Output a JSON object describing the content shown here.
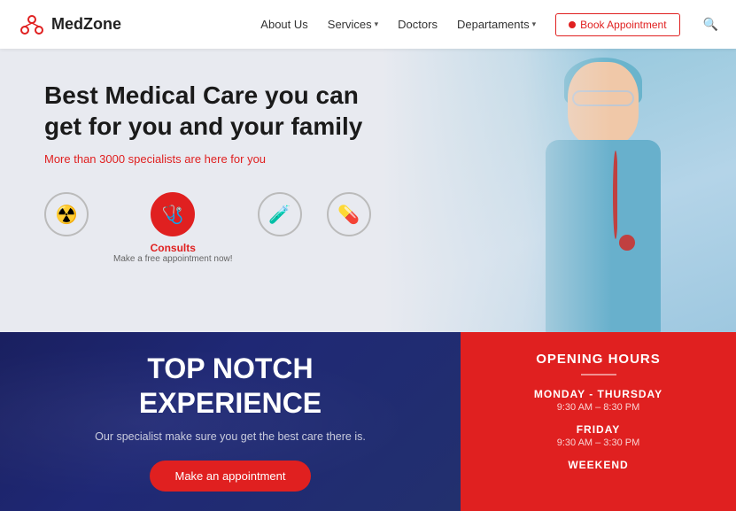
{
  "header": {
    "logo_text": "MedZone",
    "nav": {
      "about": "About Us",
      "services": "Services",
      "doctors": "Doctors",
      "departments": "Departaments",
      "book": "Book Appointment"
    }
  },
  "hero": {
    "title": "Best Medical Care you can get for you and your family",
    "subtitle": "More than 3000 specialists are here for you",
    "icons": [
      {
        "label": "",
        "sublabel": "",
        "type": "outline"
      },
      {
        "label": "Consults",
        "sublabel": "Make a free appointment now!",
        "type": "active"
      },
      {
        "label": "",
        "sublabel": "",
        "type": "outline"
      },
      {
        "label": "",
        "sublabel": "",
        "type": "outline"
      }
    ]
  },
  "left_panel": {
    "title_line1": "TOP NOTCH",
    "title_line2": "EXPERIENCE",
    "description": "Our specialist make sure you get the best care there is.",
    "btn_label": "Make an appointment"
  },
  "right_panel": {
    "title": "OPENING HOURS",
    "hours": [
      {
        "day": "MONDAY - THURSDAY",
        "time": "9:30 AM – 8:30 PM"
      },
      {
        "day": "FRIDAY",
        "time": "9:30 AM – 3:30 PM"
      },
      {
        "day": "WEEKEND",
        "time": ""
      }
    ]
  }
}
